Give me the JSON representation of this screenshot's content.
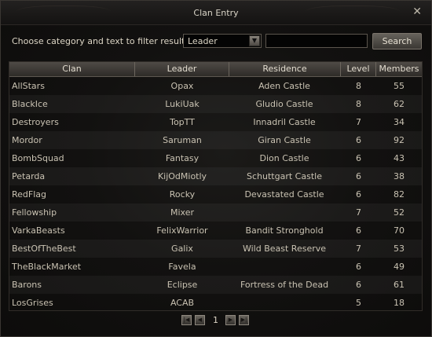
{
  "window": {
    "title": "Clan Entry"
  },
  "filter": {
    "label": "Choose category and text to filter results",
    "category_value": "Leader",
    "text_value": "",
    "search_label": "Search"
  },
  "table": {
    "headers": [
      "Clan",
      "Leader",
      "Residence",
      "Level",
      "Members"
    ],
    "rows": [
      {
        "clan": "AllStars",
        "leader": "Opax",
        "residence": "Aden Castle",
        "level": "8",
        "members": "55"
      },
      {
        "clan": "BlackIce",
        "leader": "LukiUak",
        "residence": "Gludio Castle",
        "level": "8",
        "members": "62"
      },
      {
        "clan": "Destroyers",
        "leader": "TopTT",
        "residence": "Innadril Castle",
        "level": "7",
        "members": "34"
      },
      {
        "clan": "Mordor",
        "leader": "Saruman",
        "residence": "Giran Castle",
        "level": "6",
        "members": "92"
      },
      {
        "clan": "BombSquad",
        "leader": "Fantasy",
        "residence": "Dion Castle",
        "level": "6",
        "members": "43"
      },
      {
        "clan": "Petarda",
        "leader": "KijOdMiotly",
        "residence": "Schuttgart Castle",
        "level": "6",
        "members": "38"
      },
      {
        "clan": "RedFlag",
        "leader": "Rocky",
        "residence": "Devastated Castle",
        "level": "6",
        "members": "82"
      },
      {
        "clan": "Fellowship",
        "leader": "Mixer",
        "residence": "",
        "level": "7",
        "members": "52"
      },
      {
        "clan": "VarkaBeasts",
        "leader": "FelixWarrior",
        "residence": "Bandit Stronghold",
        "level": "6",
        "members": "70"
      },
      {
        "clan": "BestOfTheBest",
        "leader": "Galix",
        "residence": "Wild Beast Reserve",
        "level": "7",
        "members": "53"
      },
      {
        "clan": "TheBlackMarket",
        "leader": "Favela",
        "residence": "",
        "level": "6",
        "members": "49"
      },
      {
        "clan": "Barons",
        "leader": "Eclipse",
        "residence": "Fortress of the Dead",
        "level": "6",
        "members": "61"
      },
      {
        "clan": "LosGrises",
        "leader": "ACAB",
        "residence": "",
        "level": "5",
        "members": "18"
      }
    ]
  },
  "pager": {
    "page": "1"
  },
  "icons": {
    "close": "close-icon",
    "dropdown": "chevron-down-icon",
    "first": "first-page-icon",
    "prev": "prev-page-icon",
    "next": "next-page-icon",
    "last": "last-page-icon"
  }
}
